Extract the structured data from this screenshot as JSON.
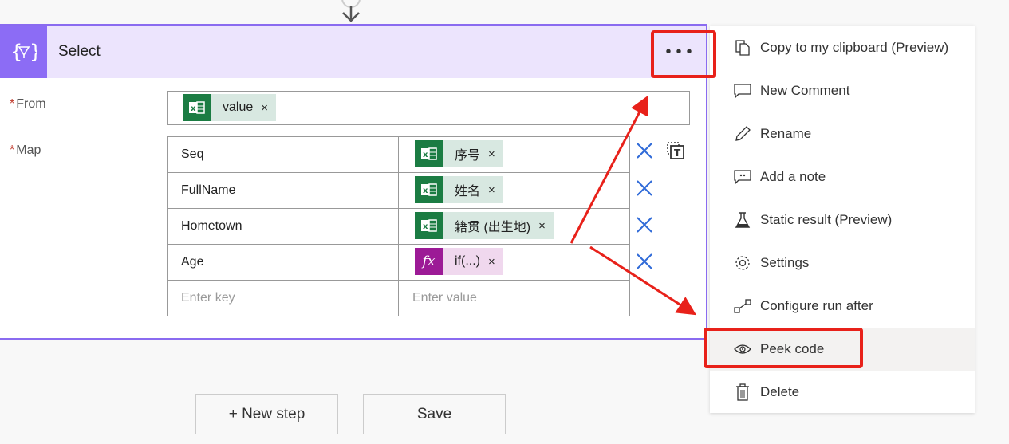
{
  "card": {
    "title": "Select",
    "icon": "select-filter-braces-icon",
    "more_label": "...",
    "accent_color": "#8c6cf5"
  },
  "from": {
    "label": "From",
    "required_marker": "*",
    "token": {
      "label": "value",
      "source": "excel",
      "remove": "×"
    }
  },
  "map": {
    "label": "Map",
    "required_marker": "*",
    "rows": [
      {
        "key": "Seq",
        "value": "序号",
        "source": "excel",
        "remove": "×"
      },
      {
        "key": "FullName",
        "value": "姓名",
        "source": "excel",
        "remove": "×"
      },
      {
        "key": "Hometown",
        "value": "籍贯 (出生地)",
        "source": "excel",
        "remove": "×"
      },
      {
        "key": "Age",
        "value": "if(...)",
        "source": "expression",
        "remove": "×"
      }
    ],
    "key_placeholder": "Enter key",
    "value_placeholder": "Enter value",
    "expression_icon_text": "fx"
  },
  "menu": {
    "items": [
      {
        "label": "Copy to my clipboard (Preview)",
        "icon": "copy-icon"
      },
      {
        "label": "New Comment",
        "icon": "comment-icon"
      },
      {
        "label": "Rename",
        "icon": "pencil-icon"
      },
      {
        "label": "Add a note",
        "icon": "note-icon"
      },
      {
        "label": "Static result (Preview)",
        "icon": "flask-icon"
      },
      {
        "label": "Settings",
        "icon": "gear-icon"
      },
      {
        "label": "Configure run after",
        "icon": "run-after-icon"
      },
      {
        "label": "Peek code",
        "icon": "eye-icon",
        "highlighted": true
      },
      {
        "label": "Delete",
        "icon": "trash-icon"
      }
    ]
  },
  "footer": {
    "new_step_label": "+ New step",
    "save_label": "Save"
  },
  "annotation_color": "#e8211a"
}
